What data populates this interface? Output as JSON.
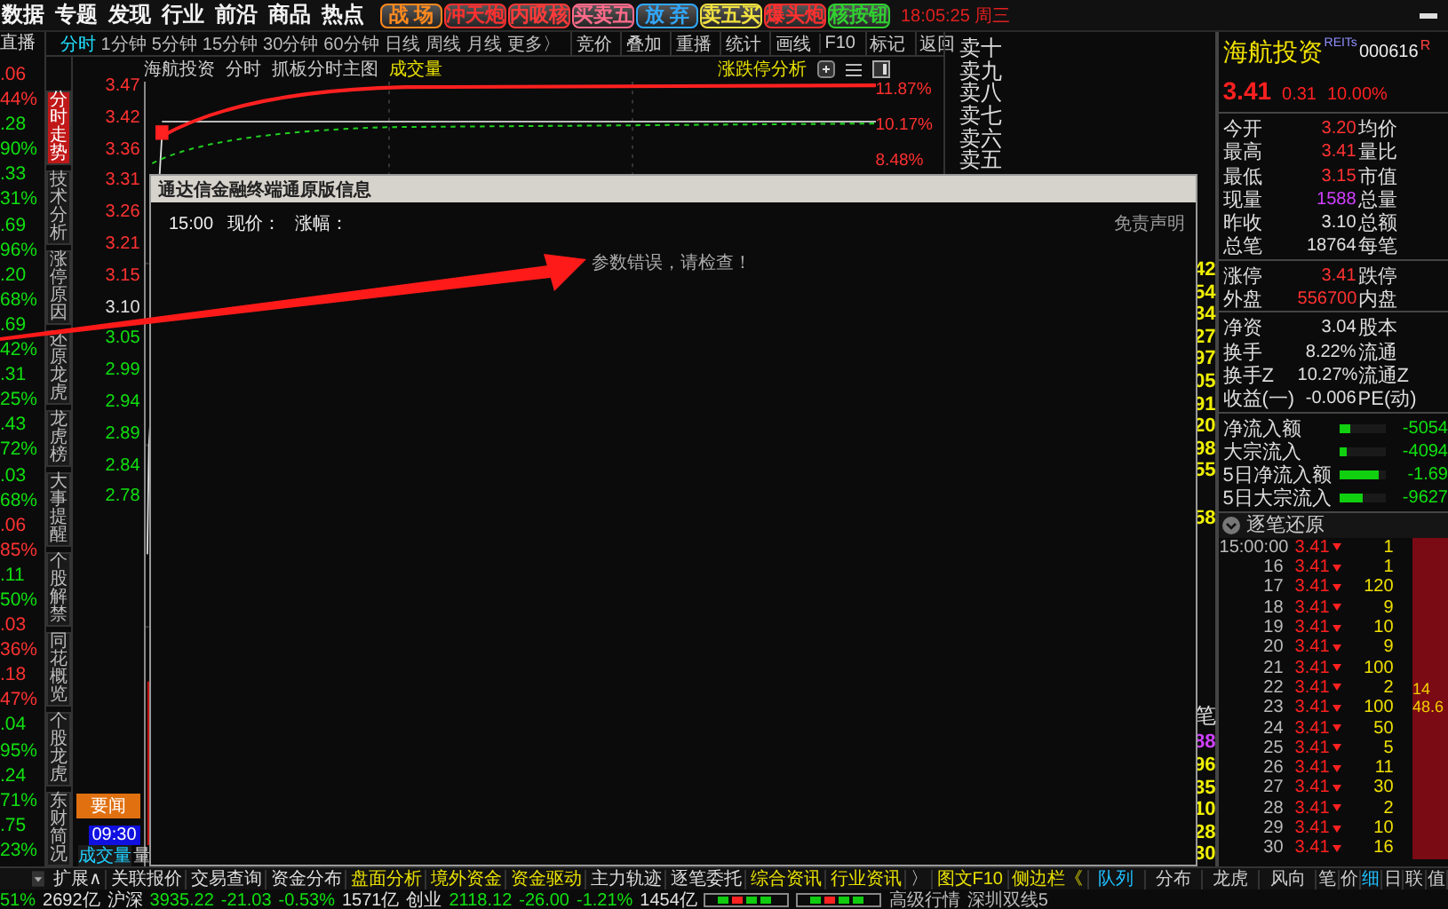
{
  "menu": [
    "数据",
    "专题",
    "发现",
    "行业",
    "前沿",
    "商品",
    "热点"
  ],
  "quick_buttons": [
    {
      "label": "战 场",
      "color": "#ff8a1e"
    },
    {
      "label": "冲天炮",
      "color": "#ff3030"
    },
    {
      "label": "内吸核",
      "color": "#ff3a3a"
    },
    {
      "label": "买卖五",
      "color": "#ff6a8a"
    },
    {
      "label": "放 弃",
      "color": "#30a8ff"
    },
    {
      "label": "卖五买",
      "color": "#f0e040"
    },
    {
      "label": "爆头炮",
      "color": "#ff3030"
    },
    {
      "label": "核按钮",
      "color": "#30d030"
    }
  ],
  "clock": "18:05:25 周三",
  "live_label": "直播",
  "quotes": [
    {
      "price": ".06",
      "change": "44%",
      "kind": "up"
    },
    {
      "price": ".28",
      "change": "90%",
      "kind": "down"
    },
    {
      "price": ".33",
      "change": "31%",
      "kind": "down"
    },
    {
      "price": ".69",
      "change": "96%",
      "kind": "down"
    },
    {
      "price": ".20",
      "change": "68%",
      "kind": "down"
    },
    {
      "price": ".69",
      "change": "42%",
      "kind": "down"
    },
    {
      "price": ".31",
      "change": "25%",
      "kind": "down"
    },
    {
      "price": ".43",
      "change": "72%",
      "kind": "down"
    },
    {
      "price": ".03",
      "change": "68%",
      "kind": "down"
    },
    {
      "price": ".06",
      "change": "85%",
      "kind": "up"
    },
    {
      "price": ".11",
      "change": "50%",
      "kind": "down"
    },
    {
      "price": ".03",
      "change": "36%",
      "kind": "up"
    },
    {
      "price": ".18",
      "change": "47%",
      "kind": "up"
    },
    {
      "price": ".04",
      "change": "95%",
      "kind": "down"
    },
    {
      "price": ".24",
      "change": "71%",
      "kind": "down"
    },
    {
      "price": ".75",
      "change": "23%",
      "kind": "down"
    }
  ],
  "period_tabs": [
    {
      "label": "分时",
      "selected": true
    },
    {
      "label": "1分钟",
      "selected": false
    },
    {
      "label": "5分钟",
      "selected": false
    },
    {
      "label": "15分钟",
      "selected": false
    },
    {
      "label": "30分钟",
      "selected": false
    },
    {
      "label": "60分钟",
      "selected": false
    },
    {
      "label": "日线",
      "selected": false
    },
    {
      "label": "周线",
      "selected": false
    },
    {
      "label": "月线",
      "selected": false
    },
    {
      "label": "更多〉",
      "selected": false
    }
  ],
  "tools": [
    "竞价",
    "叠加",
    "重播",
    "统计",
    "画线",
    "F10",
    "标记",
    "返回"
  ],
  "side_tabs": [
    {
      "label": "分时走势",
      "selected": true
    },
    {
      "label": "技术分析",
      "selected": false
    },
    {
      "label": "涨停原因",
      "selected": false
    },
    {
      "label": "还原龙虎",
      "selected": false
    },
    {
      "label": "龙虎榜",
      "selected": false
    },
    {
      "label": "大事提醒",
      "selected": false
    },
    {
      "label": "个股解禁",
      "selected": false
    },
    {
      "label": "同花概览",
      "selected": false
    },
    {
      "label": "个股龙虎",
      "selected": false
    },
    {
      "label": "东财简况",
      "selected": false
    }
  ],
  "chart": {
    "stock": "海航投资",
    "mode": "分时",
    "template": "抓板分时主图",
    "indicator": "成交量",
    "analysis": "涨跌停分析",
    "price_ticks": [
      {
        "label": "3.47",
        "kind": "up"
      },
      {
        "label": "3.42",
        "kind": "up"
      },
      {
        "label": "3.36",
        "kind": "up"
      },
      {
        "label": "3.31",
        "kind": "up"
      },
      {
        "label": "3.26",
        "kind": "up"
      },
      {
        "label": "3.21",
        "kind": "up"
      },
      {
        "label": "3.15",
        "kind": "up"
      },
      {
        "label": "3.10",
        "kind": "flat"
      },
      {
        "label": "3.05",
        "kind": "down"
      },
      {
        "label": "2.99",
        "kind": "down"
      },
      {
        "label": "2.94",
        "kind": "down"
      },
      {
        "label": "2.89",
        "kind": "down"
      },
      {
        "label": "2.84",
        "kind": "down"
      },
      {
        "label": "2.78",
        "kind": "down"
      }
    ],
    "pct_ticks": [
      "11.87%",
      "10.17%",
      "8.48%"
    ],
    "news_button": "要闻",
    "time_label": "09:30",
    "volume_tab": "成交量",
    "volume_tab_2": "量"
  },
  "order_book": {
    "sell_levels": [
      "卖十",
      "卖九",
      "卖八",
      "卖七",
      "卖六",
      "卖五"
    ],
    "column_values": [
      "42",
      "54",
      "34",
      "27",
      "97",
      "05",
      "91",
      "20",
      "98",
      "55"
    ],
    "extra_value": "58",
    "column_header": "笔",
    "volume_values": [
      {
        "text": "88",
        "kind": "volume"
      },
      {
        "text": "96",
        "kind": "count"
      },
      {
        "text": "35",
        "kind": "count"
      },
      {
        "text": "10",
        "kind": "count"
      },
      {
        "text": "28",
        "kind": "count"
      },
      {
        "text": "30",
        "kind": "count"
      }
    ]
  },
  "dialog": {
    "title": "通达信金融终端通原版信息",
    "time": "15:00",
    "price_label": "现价：",
    "change_label": "涨幅：",
    "disclaimer": "免责声明",
    "message": "参数错误，请检查！"
  },
  "stock": {
    "name": "海航投资",
    "badge": "REITs",
    "code": "000616",
    "flag": "R",
    "price": "3.41",
    "change": "0.31",
    "change_pct": "10.00%",
    "stats_main": [
      {
        "label": "今开",
        "value": "3.20",
        "kind": "up",
        "label_2": "均价"
      },
      {
        "label": "最高",
        "value": "3.41",
        "kind": "up",
        "label_2": "量比"
      },
      {
        "label": "最低",
        "value": "3.15",
        "kind": "up",
        "label_2": "市值"
      },
      {
        "label": "现量",
        "value": "1588",
        "kind": "volume",
        "label_2": "总量"
      },
      {
        "label": "昨收",
        "value": "3.10",
        "kind": "flat",
        "label_2": "总额"
      },
      {
        "label": "总笔",
        "value": "18764",
        "kind": "flat",
        "label_2": "每笔"
      }
    ],
    "stats_limit": [
      {
        "label": "涨停",
        "value": "3.41",
        "kind": "up",
        "label_2": "跌停"
      },
      {
        "label": "外盘",
        "value": "556700",
        "kind": "up",
        "label_2": "内盘"
      }
    ],
    "stats_fund": [
      {
        "label": "净资",
        "value": "3.04",
        "kind": "flat",
        "label_2": "股本"
      },
      {
        "label": "换手",
        "value": "8.22%",
        "kind": "flat",
        "label_2": "流通"
      },
      {
        "label": "换手Z",
        "value": "10.27%",
        "kind": "flat",
        "label_2": "流通Z"
      },
      {
        "label": "收益(一)",
        "value": "-0.006",
        "kind": "flat",
        "label_2": "PE(动)"
      }
    ],
    "flows": [
      {
        "label": "净流入额",
        "level": 0.22,
        "value": "-5054"
      },
      {
        "label": "大宗流入",
        "level": 0.15,
        "value": "-4094"
      },
      {
        "label": "5日净流入额",
        "level": 0.85,
        "value": "-1.69"
      },
      {
        "label": "5日大宗流入",
        "level": 0.5,
        "value": "-9627"
      }
    ]
  },
  "ticks": {
    "title": "逐笔还原",
    "rows": [
      {
        "time": "15:00:00",
        "price": "3.41",
        "volume": "1"
      },
      {
        "time": "16",
        "price": "3.41",
        "volume": "1"
      },
      {
        "time": "17",
        "price": "3.41",
        "volume": "120"
      },
      {
        "time": "18",
        "price": "3.41",
        "volume": "9"
      },
      {
        "time": "19",
        "price": "3.41",
        "volume": "10"
      },
      {
        "time": "20",
        "price": "3.41",
        "volume": "9"
      },
      {
        "time": "21",
        "price": "3.41",
        "volume": "100"
      },
      {
        "time": "22",
        "price": "3.41",
        "volume": "2"
      },
      {
        "time": "23",
        "price": "3.41",
        "volume": "100"
      },
      {
        "time": "24",
        "price": "3.41",
        "volume": "50"
      },
      {
        "time": "25",
        "price": "3.41",
        "volume": "5"
      },
      {
        "time": "26",
        "price": "3.41",
        "volume": "11"
      },
      {
        "time": "27",
        "price": "3.41",
        "volume": "30"
      },
      {
        "time": "28",
        "price": "3.41",
        "volume": "2"
      },
      {
        "time": "29",
        "price": "3.41",
        "volume": "10"
      },
      {
        "time": "30",
        "price": "3.41",
        "volume": "16"
      }
    ],
    "side_values": [
      "14",
      "48.6"
    ]
  },
  "bottom_tabs": [
    {
      "label": "扩展∧",
      "kind": "plain",
      "selected": false
    },
    {
      "label": "关联报价",
      "kind": "plain",
      "selected": false
    },
    {
      "label": "交易查询",
      "kind": "plain",
      "selected": false
    },
    {
      "label": "资金分布",
      "kind": "plain",
      "selected": false
    },
    {
      "label": "盘面分析",
      "kind": "feature",
      "selected": false
    },
    {
      "label": "境外资金",
      "kind": "feature",
      "selected": false
    },
    {
      "label": "资金驱动",
      "kind": "feature",
      "selected": false
    },
    {
      "label": "主力轨迹",
      "kind": "plain",
      "selected": false
    },
    {
      "label": "逐笔委托",
      "kind": "plain",
      "selected": false
    },
    {
      "label": "综合资讯",
      "kind": "feature",
      "selected": false
    },
    {
      "label": "行业资讯",
      "kind": "feature",
      "selected": false
    },
    {
      "label": "〉",
      "kind": "plain",
      "selected": false
    },
    {
      "label": "图文F10",
      "kind": "feature",
      "selected": false
    },
    {
      "label": "侧边栏《",
      "kind": "feature",
      "selected": false
    }
  ],
  "panel_tabs": [
    {
      "label": "队列",
      "selected": true
    },
    {
      "label": "分布",
      "selected": false
    },
    {
      "label": "龙虎",
      "selected": false
    },
    {
      "label": "风向",
      "selected": false
    }
  ],
  "mini_tabs": [
    {
      "label": "笔",
      "selected": false
    },
    {
      "label": "价",
      "selected": false
    },
    {
      "label": "细",
      "selected": true
    },
    {
      "label": "日",
      "selected": false
    },
    {
      "label": "联",
      "selected": false
    },
    {
      "label": "值",
      "selected": false
    }
  ],
  "status": {
    "items": [
      {
        "text": "51%",
        "kind": "down"
      },
      {
        "text": "2692亿",
        "kind": "flat"
      },
      {
        "text": "沪深",
        "kind": "flat"
      },
      {
        "text": "3935.22",
        "kind": "down"
      },
      {
        "text": "-21.03",
        "kind": "down"
      },
      {
        "text": "-0.53%",
        "kind": "down"
      },
      {
        "text": "1571亿",
        "kind": "flat"
      },
      {
        "text": "创业",
        "kind": "flat"
      },
      {
        "text": "2118.12",
        "kind": "down"
      },
      {
        "text": "-26.00",
        "kind": "down"
      },
      {
        "text": "-1.21%",
        "kind": "down"
      },
      {
        "text": "1454亿",
        "kind": "flat"
      }
    ],
    "right_items": [
      "高级行情",
      "深圳双线5"
    ]
  }
}
